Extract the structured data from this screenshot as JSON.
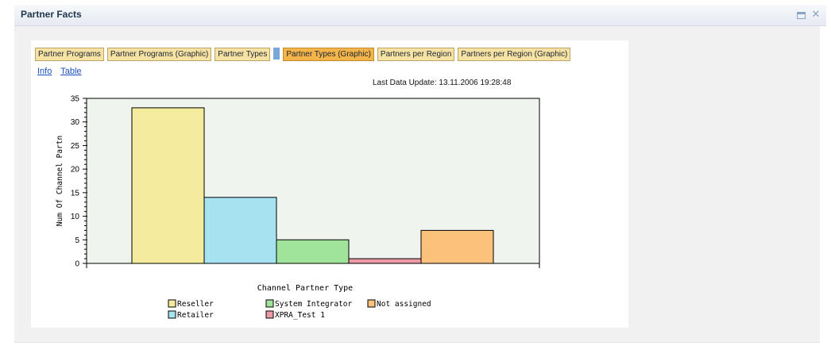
{
  "window": {
    "title": "Partner Facts"
  },
  "icons": {
    "maximize": "maximize-icon",
    "close": "close-icon"
  },
  "tabs": [
    {
      "label": "Partner Programs",
      "active": false
    },
    {
      "label": "Partner Programs (Graphic)",
      "active": false
    },
    {
      "label": "Partner Types",
      "active": false
    },
    {
      "label": "Partner Types (Graphic)",
      "active": true
    },
    {
      "label": "Partners per Region",
      "active": false
    },
    {
      "label": "Partners per Region (Graphic)",
      "active": false
    }
  ],
  "links": {
    "info": "Info",
    "table": "Table"
  },
  "last_update": "Last Data Update: 13.11.2006 19:28:48",
  "chart_data": {
    "type": "bar",
    "title": "",
    "xlabel": "Channel Partner Type",
    "ylabel": "Num Of Channel Partn",
    "ylim": [
      0,
      35
    ],
    "yticks": [
      0,
      5,
      10,
      15,
      20,
      25,
      30,
      35
    ],
    "grid": false,
    "legend_position": "bottom",
    "categories": [
      "Reseller",
      "Retailer",
      "System Integrator",
      "XPRA_Test 1",
      "Not assigned"
    ],
    "values": [
      33,
      14,
      5,
      1,
      7
    ],
    "colors": [
      "#f4eb9d",
      "#a6e3f0",
      "#a0e39a",
      "#eb9aa6",
      "#fcc27c"
    ],
    "plot_background": "#eff5ee"
  }
}
